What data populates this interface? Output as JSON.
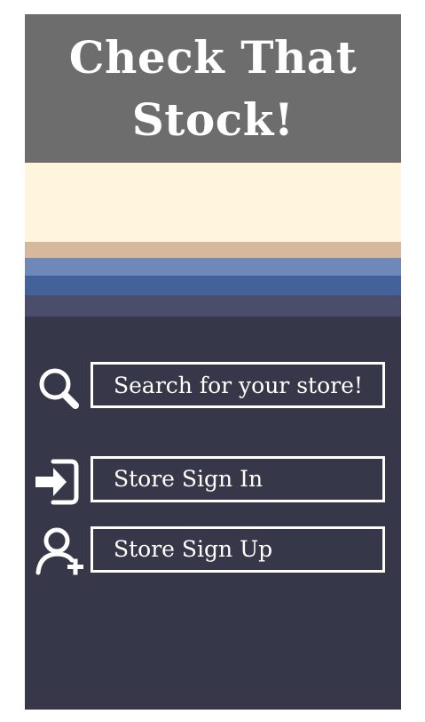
{
  "header": {
    "title": "Check That Stock!"
  },
  "search": {
    "placeholder": "Search for your store!",
    "icon": "search-icon"
  },
  "actions": {
    "sign_in_label": "Store Sign In",
    "sign_in_icon": "sign-in-icon",
    "sign_up_label": "Store Sign Up",
    "sign_up_icon": "user-plus-icon"
  },
  "colors": {
    "background": "#363849",
    "header": "#6d6d6d",
    "stripes": [
      "#fff4de",
      "#d6b99d",
      "#6e88b8",
      "#44629a",
      "#4a4d6b"
    ]
  }
}
